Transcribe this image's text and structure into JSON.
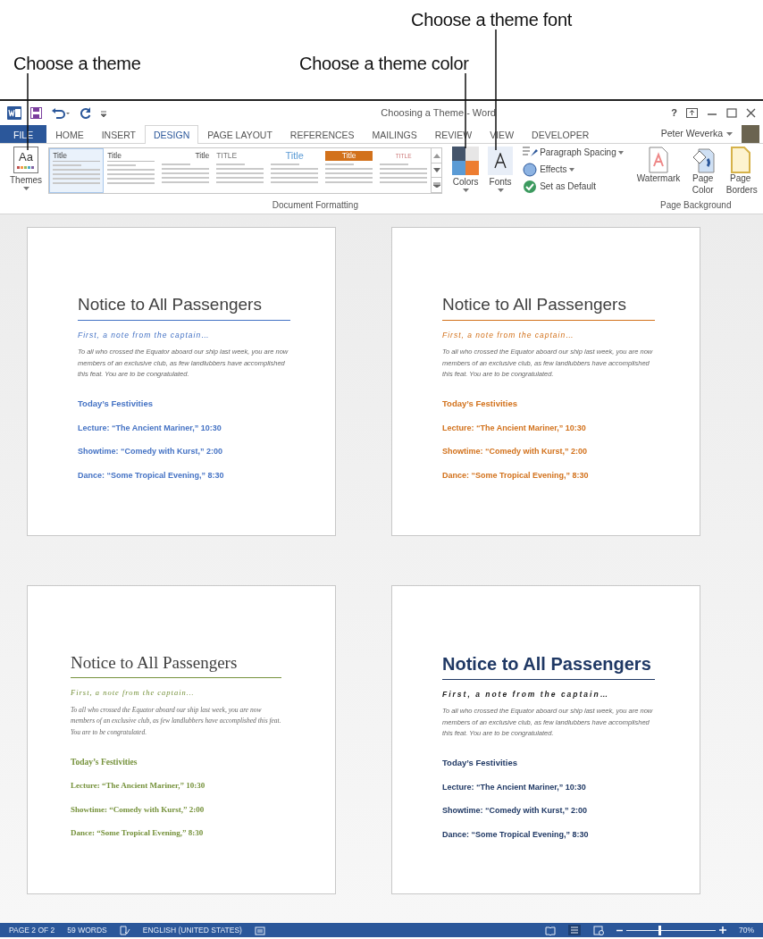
{
  "annotations": [
    {
      "text": "Choose a theme"
    },
    {
      "text": "Choose a theme color"
    },
    {
      "text": "Choose a theme font"
    }
  ],
  "window": {
    "title": "Choosing a Theme - Word",
    "help": "?"
  },
  "tabs": [
    {
      "label": "FILE",
      "kind": "file",
      "selected": false
    },
    {
      "label": "HOME",
      "kind": "tab",
      "selected": false
    },
    {
      "label": "INSERT",
      "kind": "tab",
      "selected": false
    },
    {
      "label": "DESIGN",
      "kind": "tab",
      "selected": true
    },
    {
      "label": "PAGE LAYOUT",
      "kind": "tab",
      "selected": false
    },
    {
      "label": "REFERENCES",
      "kind": "tab",
      "selected": false
    },
    {
      "label": "MAILINGS",
      "kind": "tab",
      "selected": false
    },
    {
      "label": "REVIEW",
      "kind": "tab",
      "selected": false
    },
    {
      "label": "VIEW",
      "kind": "tab",
      "selected": false
    },
    {
      "label": "DEVELOPER",
      "kind": "tab",
      "selected": false
    }
  ],
  "user": "Peter Weverka",
  "ribbon": {
    "themes_icon": "Aa",
    "themes": "Themes",
    "gallery": [
      {
        "title": "Title",
        "kind": "left",
        "selected": true
      },
      {
        "title": "Title",
        "kind": "left",
        "selected": false
      },
      {
        "title": "Title",
        "kind": "right",
        "selected": false
      },
      {
        "title": "TITLE",
        "kind": "caps",
        "selected": false
      },
      {
        "title": "Title",
        "kind": "large",
        "selected": false
      },
      {
        "title": "Title",
        "kind": "banner",
        "selected": false
      },
      {
        "title": "TITLE",
        "kind": "center",
        "selected": false
      }
    ],
    "colors": "Colors",
    "fonts": "Fonts",
    "small_buttons": [
      "Paragraph Spacing",
      "Effects",
      "Set as Default"
    ],
    "document_formatting": "Document Formatting",
    "page_background_buttons": [
      "Watermark",
      "Page Color",
      "Page Borders"
    ],
    "page_background": "Page Background"
  },
  "pages": [
    {
      "kind": "light",
      "color": "#4472c4",
      "title": "Notice to All Passengers",
      "subtitle": "First, a note from the captain…",
      "body": "To all who crossed the Equator aboard our ship last week, you are now members of an exclusive club, as few landlubbers have accomplished this feat. You are to be congratulated.",
      "heading": "Today’s Festivities",
      "items": [
        "Lecture: “The Ancient Mariner,” 10:30",
        "Showtime: “Comedy with Kurst,” 2:00",
        "Dance: “Some Tropical Evening,” 8:30"
      ]
    },
    {
      "kind": "light",
      "color": "#d2711b",
      "title": "Notice to All Passengers",
      "subtitle": "First, a note from the captain…",
      "body": "To all who crossed the Equator aboard our ship last week, you are now members of an exclusive club, as few landlubbers have accomplished this feat. You are to be congratulated.",
      "heading": "Today’s Festivities",
      "items": [
        "Lecture: “The Ancient Mariner,” 10:30",
        "Showtime: “Comedy with Kurst,” 2:00",
        "Dance: “Some Tropical Evening,” 8:30"
      ]
    },
    {
      "kind": "serif",
      "color": "#76923c",
      "title": "Notice to All Passengers",
      "subtitle": "First, a note from the captain…",
      "body": "To all who crossed the Equator aboard our ship last week, you are now members of an exclusive club, as few landlubbers have accomplished this feat. You are to be congratulated.",
      "heading": "Today’s Festivities",
      "items": [
        "Lecture: “The Ancient Mariner,” 10:30",
        "Showtime: “Comedy with Kurst,” 2:00",
        "Dance: “Some Tropical Evening,” 8:30"
      ]
    },
    {
      "kind": "bold",
      "color": "#1f3864",
      "title": "Notice to All Passengers",
      "subtitle": "First, a note from the captain…",
      "body": "To all who crossed the Equator aboard our ship last week, you are now members of an exclusive club, as few landlubbers have accomplished this feat. You are to be congratulated.",
      "heading": "Today’s Festivities",
      "items": [
        "Lecture: “The Ancient Mariner,” 10:30",
        "Showtime: “Comedy with Kurst,” 2:00",
        "Dance: “Some Tropical Evening,” 8:30"
      ]
    }
  ],
  "status_bar": {
    "items": [
      "PAGE 2 OF 2",
      "59 WORDS",
      "ENGLISH (UNITED STATES)"
    ],
    "zoom": "70%",
    "zoom_level": {
      "level": 0.38
    }
  }
}
